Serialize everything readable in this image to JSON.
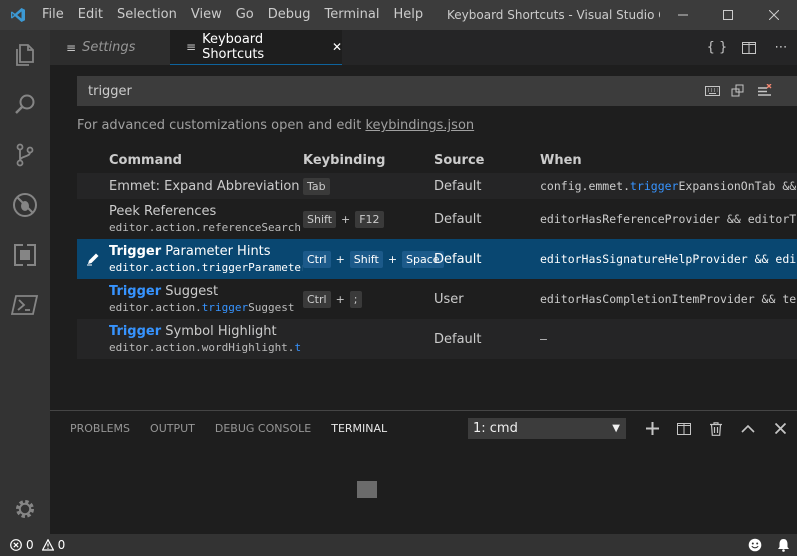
{
  "titlebar": {
    "menu": [
      "File",
      "Edit",
      "Selection",
      "View",
      "Go",
      "Debug",
      "Terminal",
      "Help"
    ],
    "window_title": "Keyboard Shortcuts - Visual Studio Co..."
  },
  "tabs": {
    "settings": "Settings",
    "keyboard_shortcuts": "Keyboard Shortcuts"
  },
  "editor": {
    "search_value": "trigger",
    "advanced_prefix": "For advanced customizations open and edit ",
    "advanced_link": "keybindings.json",
    "columns": [
      "Command",
      "Keybinding",
      "Source",
      "When"
    ],
    "rows": [
      {
        "title": "Emmet: Expand Abbreviation",
        "id": "",
        "keys": [
          "Tab"
        ],
        "source": "Default",
        "when_pre": "config.emmet.",
        "when_hl": "trigger",
        "when_post": "ExpansionOnTab &&..."
      },
      {
        "title": "Peek References",
        "id": "editor.action.referenceSearch",
        "keys": [
          "Shift",
          "F12"
        ],
        "source": "Default",
        "when_pre": "editorHasReferenceProvider && editorT...",
        "when_hl": "",
        "when_post": ""
      },
      {
        "title_hl": "Trigger",
        "title_rest": " Parameter Hints",
        "id_pre": "editor.action.",
        "id_hl": "trigger",
        "id_post": "Parameter",
        "keys": [
          "Ctrl",
          "Shift",
          "Space"
        ],
        "source": "Default",
        "when_pre": "editorHasSignatureHelpProvider && edi...",
        "when_hl": "",
        "when_post": ""
      },
      {
        "title_hl": "Trigger",
        "title_rest": " Suggest",
        "id_pre": "editor.action.",
        "id_hl": "trigger",
        "id_post": "Suggest",
        "keys": [
          "Ctrl",
          ";"
        ],
        "source": "User",
        "when_pre": "editorHasCompletionItemProvider && te...",
        "when_hl": "",
        "when_post": ""
      },
      {
        "title_hl": "Trigger",
        "title_rest": " Symbol Highlight",
        "id_pre": "editor.action.wordHighlight.",
        "id_hl": "t",
        "id_post": "",
        "keys": [],
        "source": "Default",
        "when_pre": "—",
        "when_hl": "",
        "when_post": ""
      }
    ]
  },
  "panel": {
    "tabs": [
      "PROBLEMS",
      "OUTPUT",
      "DEBUG CONSOLE",
      "TERMINAL"
    ],
    "terminal_select": "1: cmd"
  },
  "statusbar": {
    "errors": "0",
    "warnings": "0"
  },
  "colors": {
    "accent": "#0e639c",
    "selection": "#094771",
    "highlight": "#3794ff",
    "logo": "#3c99d4"
  }
}
